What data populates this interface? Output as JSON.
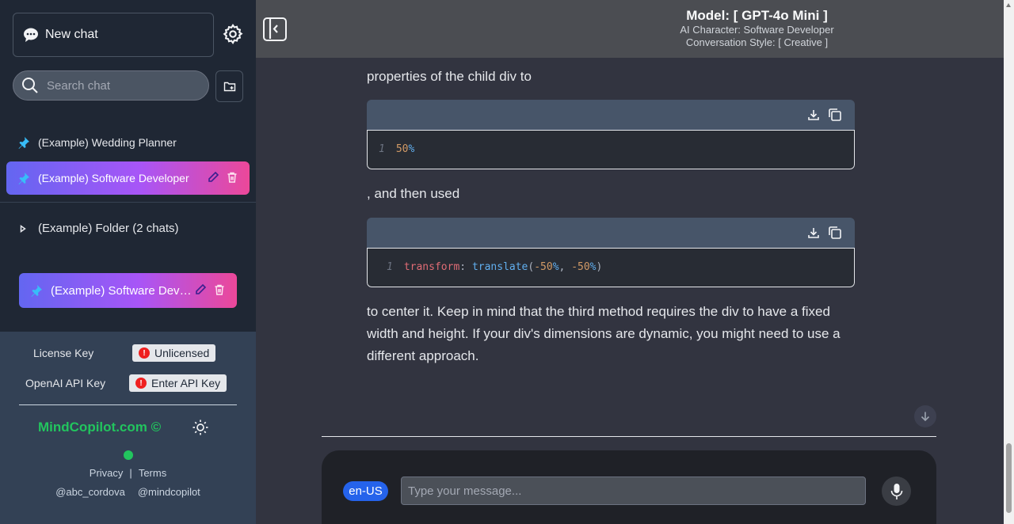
{
  "sidebar": {
    "new_chat_label": "New chat",
    "search_placeholder": "Search chat",
    "chats": [
      {
        "title": "(Example) Wedding Planner"
      },
      {
        "title": "(Example) Software Developer"
      }
    ],
    "folder": {
      "title": "(Example) Folder (2 chats)"
    },
    "folder_chat": {
      "title": "(Example) Software Developer"
    },
    "license_label": "License Key",
    "license_status": "Unlicensed",
    "api_label": "OpenAI API Key",
    "api_button": "Enter API Key",
    "brand": "MindCopilot.com ©",
    "privacy": "Privacy",
    "separator": "|",
    "terms": "Terms",
    "social_1": "@abc_cordova",
    "social_2": "@mindcopilot"
  },
  "header": {
    "model": "Model: [ GPT-4o Mini ]",
    "character": "AI Character: Software Developer",
    "style": "Conversation Style: [ Creative ]"
  },
  "message": {
    "p1": "properties of the child div to",
    "code1": {
      "line": "1",
      "value": "50",
      "unit": "%"
    },
    "p2": ", and then used",
    "code2": {
      "line": "1",
      "prop": "transform",
      "colon": ": ",
      "fn": "translate",
      "open": "(",
      "n1": "-50",
      "u1": "%",
      "comma": ", ",
      "n2": "-50",
      "u2": "%",
      "close": ")"
    },
    "p3": "to center it. Keep in mind that the third method requires the div to have a fixed width and height. If your div's dimensions are dynamic, you might need to use a different approach."
  },
  "input": {
    "language": "en-US",
    "placeholder": "Type your message..."
  },
  "colors": {
    "accent_gradient_start": "#6366f1",
    "accent_gradient_end": "#ec4899",
    "brand_green": "#22c55e",
    "language_badge": "#2563eb"
  }
}
